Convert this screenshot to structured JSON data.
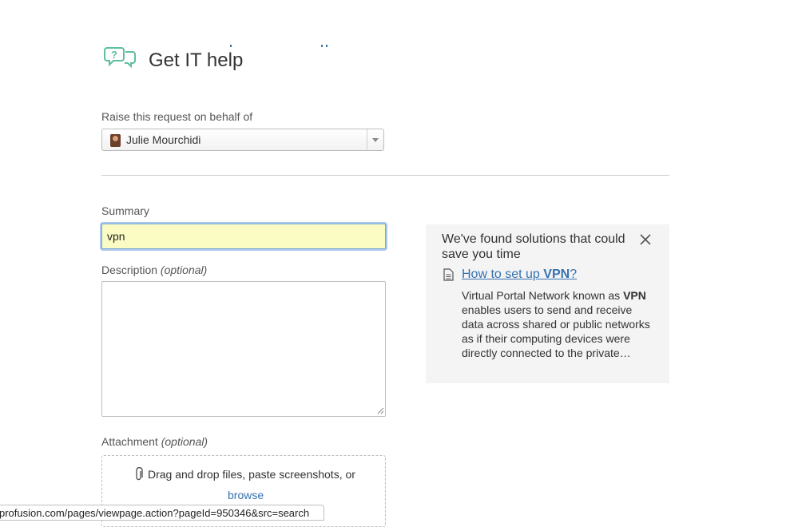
{
  "header": {
    "title": "Get IT help",
    "icon": "help-bubbles-icon"
  },
  "form": {
    "behalf": {
      "label": "Raise this request on behalf of",
      "selected": "Julie Mourchidi"
    },
    "summary": {
      "label": "Summary",
      "value": "vpn"
    },
    "description": {
      "label": "Description",
      "optional": "(optional)",
      "value": ""
    },
    "attachment": {
      "label": "Attachment",
      "optional": "(optional)",
      "drop_text": "Drag and drop files, paste screenshots, or",
      "browse_label": "browse"
    }
  },
  "suggestions": {
    "heading": "We've found solutions that could save you time",
    "article": {
      "title_prefix": "How to set up ",
      "title_highlight": "VPN",
      "title_suffix": "?",
      "excerpt_prefix": "Virtual Portal Network known as ",
      "excerpt_highlight": "VPN",
      "excerpt_suffix": " enables users to send and receive data across shared or public networks as if their computing devices were directly connected to the private…"
    }
  },
  "status_bar": {
    "url": "profusion.com/pages/viewpage.action?pageId=950346&src=search"
  },
  "colors": {
    "accent_icon": "#5fbf9f",
    "link": "#3572b0",
    "summary_bg": "#fbfcc3",
    "panel_bg": "#f4f4f4"
  }
}
